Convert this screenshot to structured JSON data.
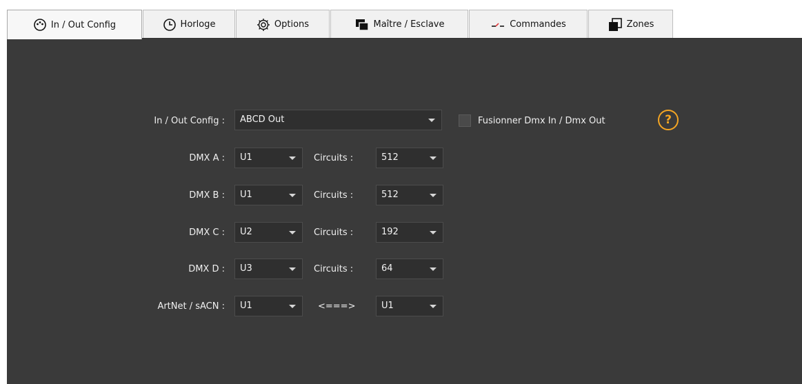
{
  "tabs": [
    {
      "label": "In / Out Config",
      "icon": "dmx-connector-icon"
    },
    {
      "label": "Horloge",
      "icon": "clock-icon"
    },
    {
      "label": "Options",
      "icon": "gear-icon"
    },
    {
      "label": "Maître / Esclave",
      "icon": "master-slave-icon"
    },
    {
      "label": "Commandes",
      "icon": "commands-icon"
    },
    {
      "label": "Zones",
      "icon": "zones-icon"
    }
  ],
  "config": {
    "label": "In / Out Config :",
    "value": "ABCD Out",
    "merge_label": "Fusionner Dmx In / Dmx Out",
    "merge_checked": false,
    "help": "?"
  },
  "rows": [
    {
      "label": "DMX A :",
      "universe": "U1",
      "circuits_label": "Circuits :",
      "circuits": "512"
    },
    {
      "label": "DMX B :",
      "universe": "U1",
      "circuits_label": "Circuits :",
      "circuits": "512"
    },
    {
      "label": "DMX C :",
      "universe": "U2",
      "circuits_label": "Circuits :",
      "circuits": "192"
    },
    {
      "label": "DMX D :",
      "universe": "U3",
      "circuits_label": "Circuits :",
      "circuits": "64"
    }
  ],
  "artnet": {
    "label": "ArtNet / sACN :",
    "universe": "U1",
    "arrow": "<===>",
    "target": "U1"
  },
  "colors": {
    "panel": "#3a3a3a",
    "accent": "#f5a623",
    "tab_bg": "#f1f1f1"
  }
}
